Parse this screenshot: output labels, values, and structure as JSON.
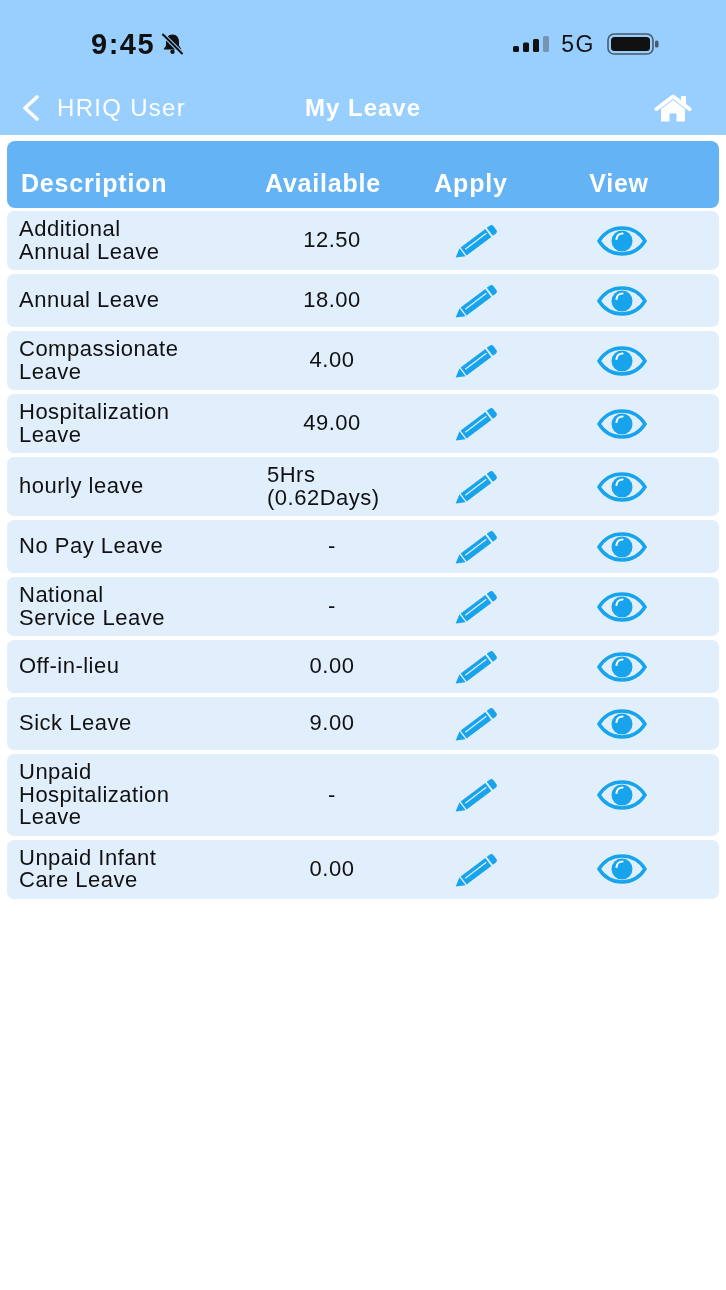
{
  "status_bar": {
    "time": "9:45",
    "silent_mode": true,
    "network": "5G"
  },
  "nav": {
    "back_label": "HRIQ User",
    "title": "My Leave"
  },
  "table": {
    "columns": [
      "Description",
      "Available",
      "Apply",
      "View"
    ],
    "rows": [
      {
        "description": "Additional Annual Leave",
        "available": "12.50"
      },
      {
        "description": "Annual Leave",
        "available": "18.00"
      },
      {
        "description": "Compassionate Leave",
        "available": "4.00"
      },
      {
        "description": "Hospitalization Leave",
        "available": "49.00"
      },
      {
        "description": "hourly leave",
        "available": "5Hrs (0.62Days)"
      },
      {
        "description": "No Pay Leave",
        "available": "-"
      },
      {
        "description": "National Service Leave",
        "available": "-"
      },
      {
        "description": "Off-in-lieu",
        "available": "0.00"
      },
      {
        "description": "Sick Leave",
        "available": "9.00"
      },
      {
        "description": "Unpaid Hospitalization Leave",
        "available": "-"
      },
      {
        "description": "Unpaid Infant Care Leave",
        "available": "0.00"
      }
    ]
  }
}
